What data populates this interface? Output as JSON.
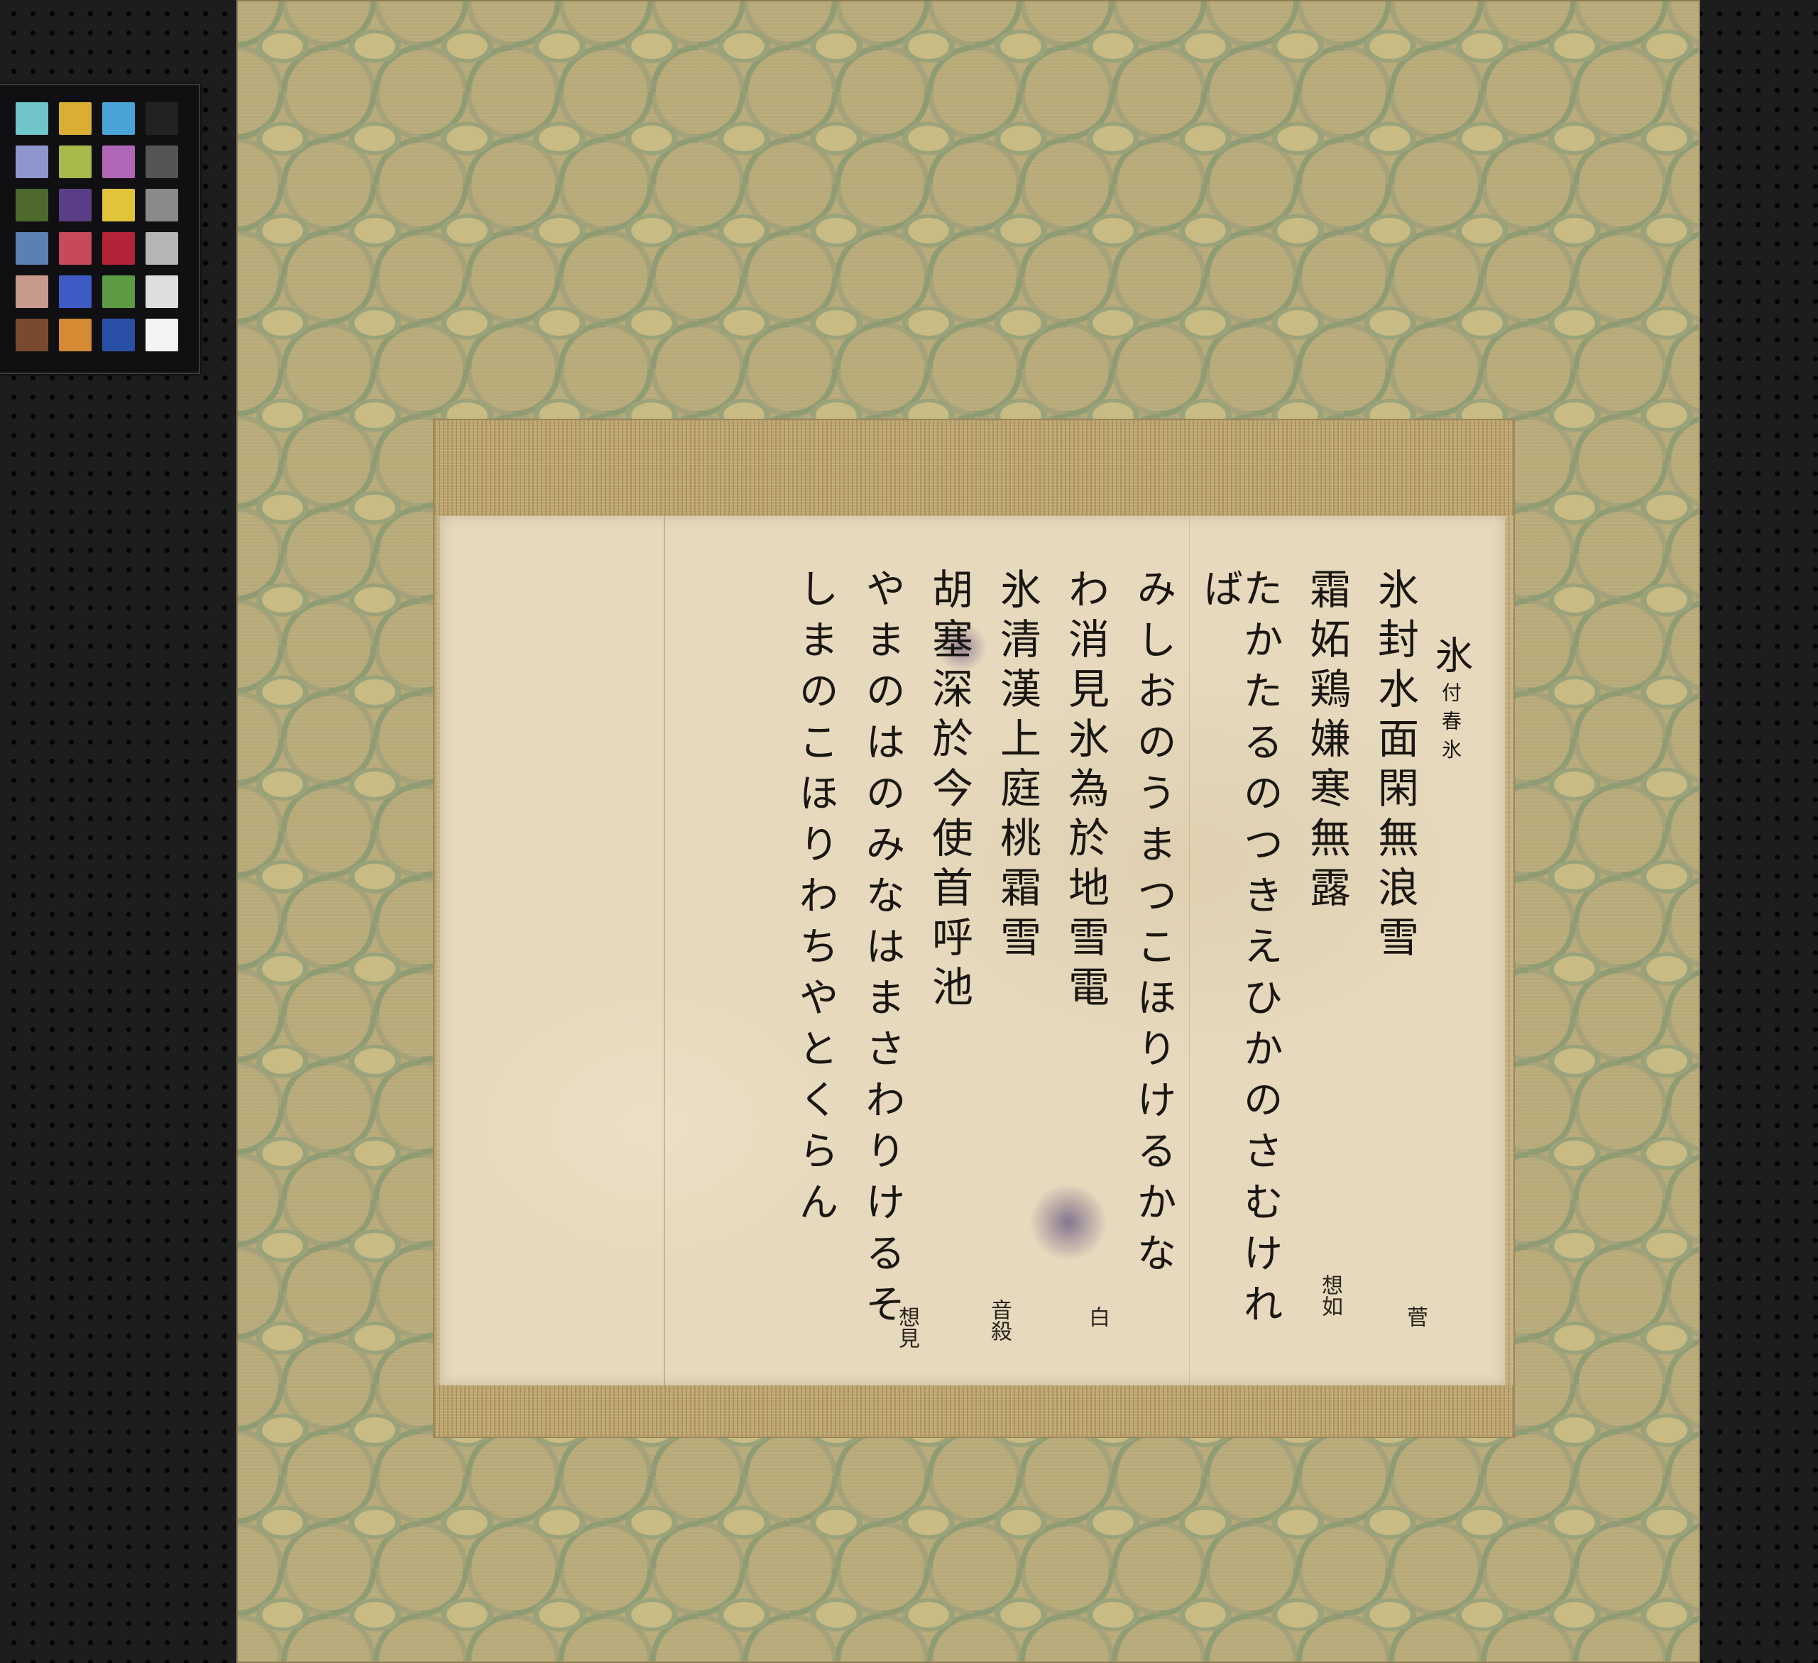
{
  "color_checker": {
    "patches": [
      "#6fc5c8",
      "#d8ae33",
      "#4aa3d6",
      "#222222",
      "#8f96cf",
      "#a9b94a",
      "#b066b6",
      "#555555",
      "#4d6a2c",
      "#5a3f86",
      "#e2c43b",
      "#8a8a8a",
      "#5b80b4",
      "#c74a5b",
      "#b4233a",
      "#b5b5b5",
      "#c89a8c",
      "#3e5bc4",
      "#5c9a44",
      "#dedede",
      "#7a4a2e",
      "#d68a31",
      "#2a4fa6",
      "#f3f3f3"
    ]
  },
  "calligraphy": {
    "title": "氷",
    "title_note": "付春氷",
    "columns": [
      {
        "text": "氷封水面閑無浪雪",
        "note": "菅"
      },
      {
        "text": "霜妬鶏嫌寒無露",
        "note": "想如"
      },
      {
        "text": "たかたるのつきえひかのさむければ",
        "note": ""
      },
      {
        "text": "みしおのうまつこほりけるかな",
        "note": ""
      },
      {
        "text": "わ消見氷為於地雪電",
        "note": "白"
      },
      {
        "text": "氷清漢上庭桃霜雪",
        "note": "音殺"
      },
      {
        "text": "胡塞深於今使首呼池",
        "note": "想見"
      },
      {
        "text": "やまのはのみなはまさわりけるそ",
        "note": ""
      },
      {
        "text": "しまのこほりわちやとくらん",
        "note": ""
      }
    ]
  }
}
